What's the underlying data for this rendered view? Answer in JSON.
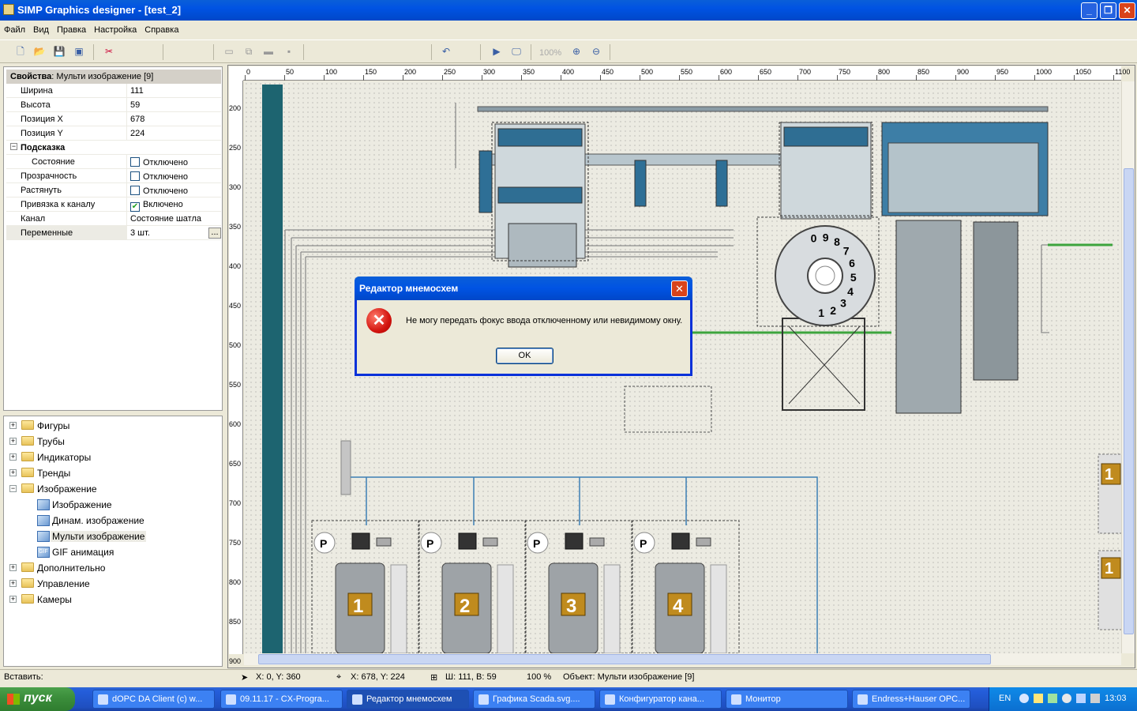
{
  "window": {
    "title": "SIMP Graphics designer - [test_2]"
  },
  "menu": [
    "Файл",
    "Вид",
    "Правка",
    "Настройка",
    "Справка"
  ],
  "toolbar": {
    "zoom": "100%"
  },
  "properties": {
    "header_bold": "Свойства",
    "header_rest": ": Мульти изображение [9]",
    "rows": [
      {
        "name": "Ширина",
        "value": "111"
      },
      {
        "name": "Высота",
        "value": "59"
      },
      {
        "name": "Позиция X",
        "value": "678"
      },
      {
        "name": "Позиция Y",
        "value": "224"
      }
    ],
    "group": "Подсказка",
    "rows2": [
      {
        "name": "Состояние",
        "value": "Отключено",
        "checked": false
      },
      {
        "name": "Прозрачность",
        "value": "Отключено",
        "checked": false
      },
      {
        "name": "Растянуть",
        "value": "Отключено",
        "checked": false
      },
      {
        "name": "Привязка к каналу",
        "value": "Включено",
        "checked": true
      },
      {
        "name": "Канал",
        "value": "Состояние шатла"
      },
      {
        "name": "Переменные",
        "value": "3 шт.",
        "button": "..."
      }
    ]
  },
  "tree": {
    "items": [
      {
        "label": "Фигуры",
        "expander": "+"
      },
      {
        "label": "Трубы",
        "expander": "+"
      },
      {
        "label": "Индикаторы",
        "expander": "+"
      },
      {
        "label": "Тренды",
        "expander": "+"
      },
      {
        "label": "Изображение",
        "expander": "−"
      },
      {
        "label": "Изображение",
        "child": true
      },
      {
        "label": "Динам. изображение",
        "child": true
      },
      {
        "label": "Мульти изображение",
        "child": true,
        "selected": true
      },
      {
        "label": "GIF анимация",
        "child": true,
        "gif": "GIF"
      },
      {
        "label": "Дополнительно",
        "expander": "+"
      },
      {
        "label": "Управление",
        "expander": "+"
      },
      {
        "label": "Камеры",
        "expander": "+"
      }
    ]
  },
  "ruler": {
    "h": [
      "0",
      "50",
      "100",
      "150",
      "200",
      "250",
      "300",
      "350",
      "400",
      "450",
      "500",
      "550",
      "600",
      "650",
      "700",
      "750",
      "800",
      "850",
      "900",
      "950",
      "1000",
      "1050",
      "1100"
    ],
    "v": [
      "200",
      "250",
      "300",
      "350",
      "400",
      "450",
      "500",
      "550",
      "600",
      "650",
      "700",
      "750",
      "800",
      "850",
      "900"
    ]
  },
  "canvas": {
    "tanks": [
      "1",
      "2",
      "3",
      "4"
    ],
    "valve_letter": "P",
    "rotary_numbers": [
      "0",
      "9",
      "8",
      "7",
      "6",
      "5",
      "4",
      "3",
      "2",
      "1"
    ],
    "edge_labels": [
      "1",
      "1"
    ]
  },
  "dialog": {
    "title": "Редактор мнемосхем",
    "message": "Не могу передать фокус ввода отключенному или невидимому окну.",
    "ok": "OK"
  },
  "status": {
    "insert": "Вставить:",
    "cursor": "X: 0, Y: 360",
    "pos": "X: 678, Y: 224",
    "size": "Ш: 111, В: 59",
    "zoom": "100 %",
    "object": "Объект: Мульти изображение [9]"
  },
  "taskbar": {
    "start": "пуск",
    "tasks": [
      "dOPC DA Client (c) w...",
      "09.11.17 - CX-Progra...",
      "Редактор мнемосхем",
      "Графика Scada.svg....",
      "Конфигуратор кана...",
      "Монитор",
      "Endress+Hauser OPC..."
    ],
    "lang": "EN",
    "clock": "13:03"
  }
}
